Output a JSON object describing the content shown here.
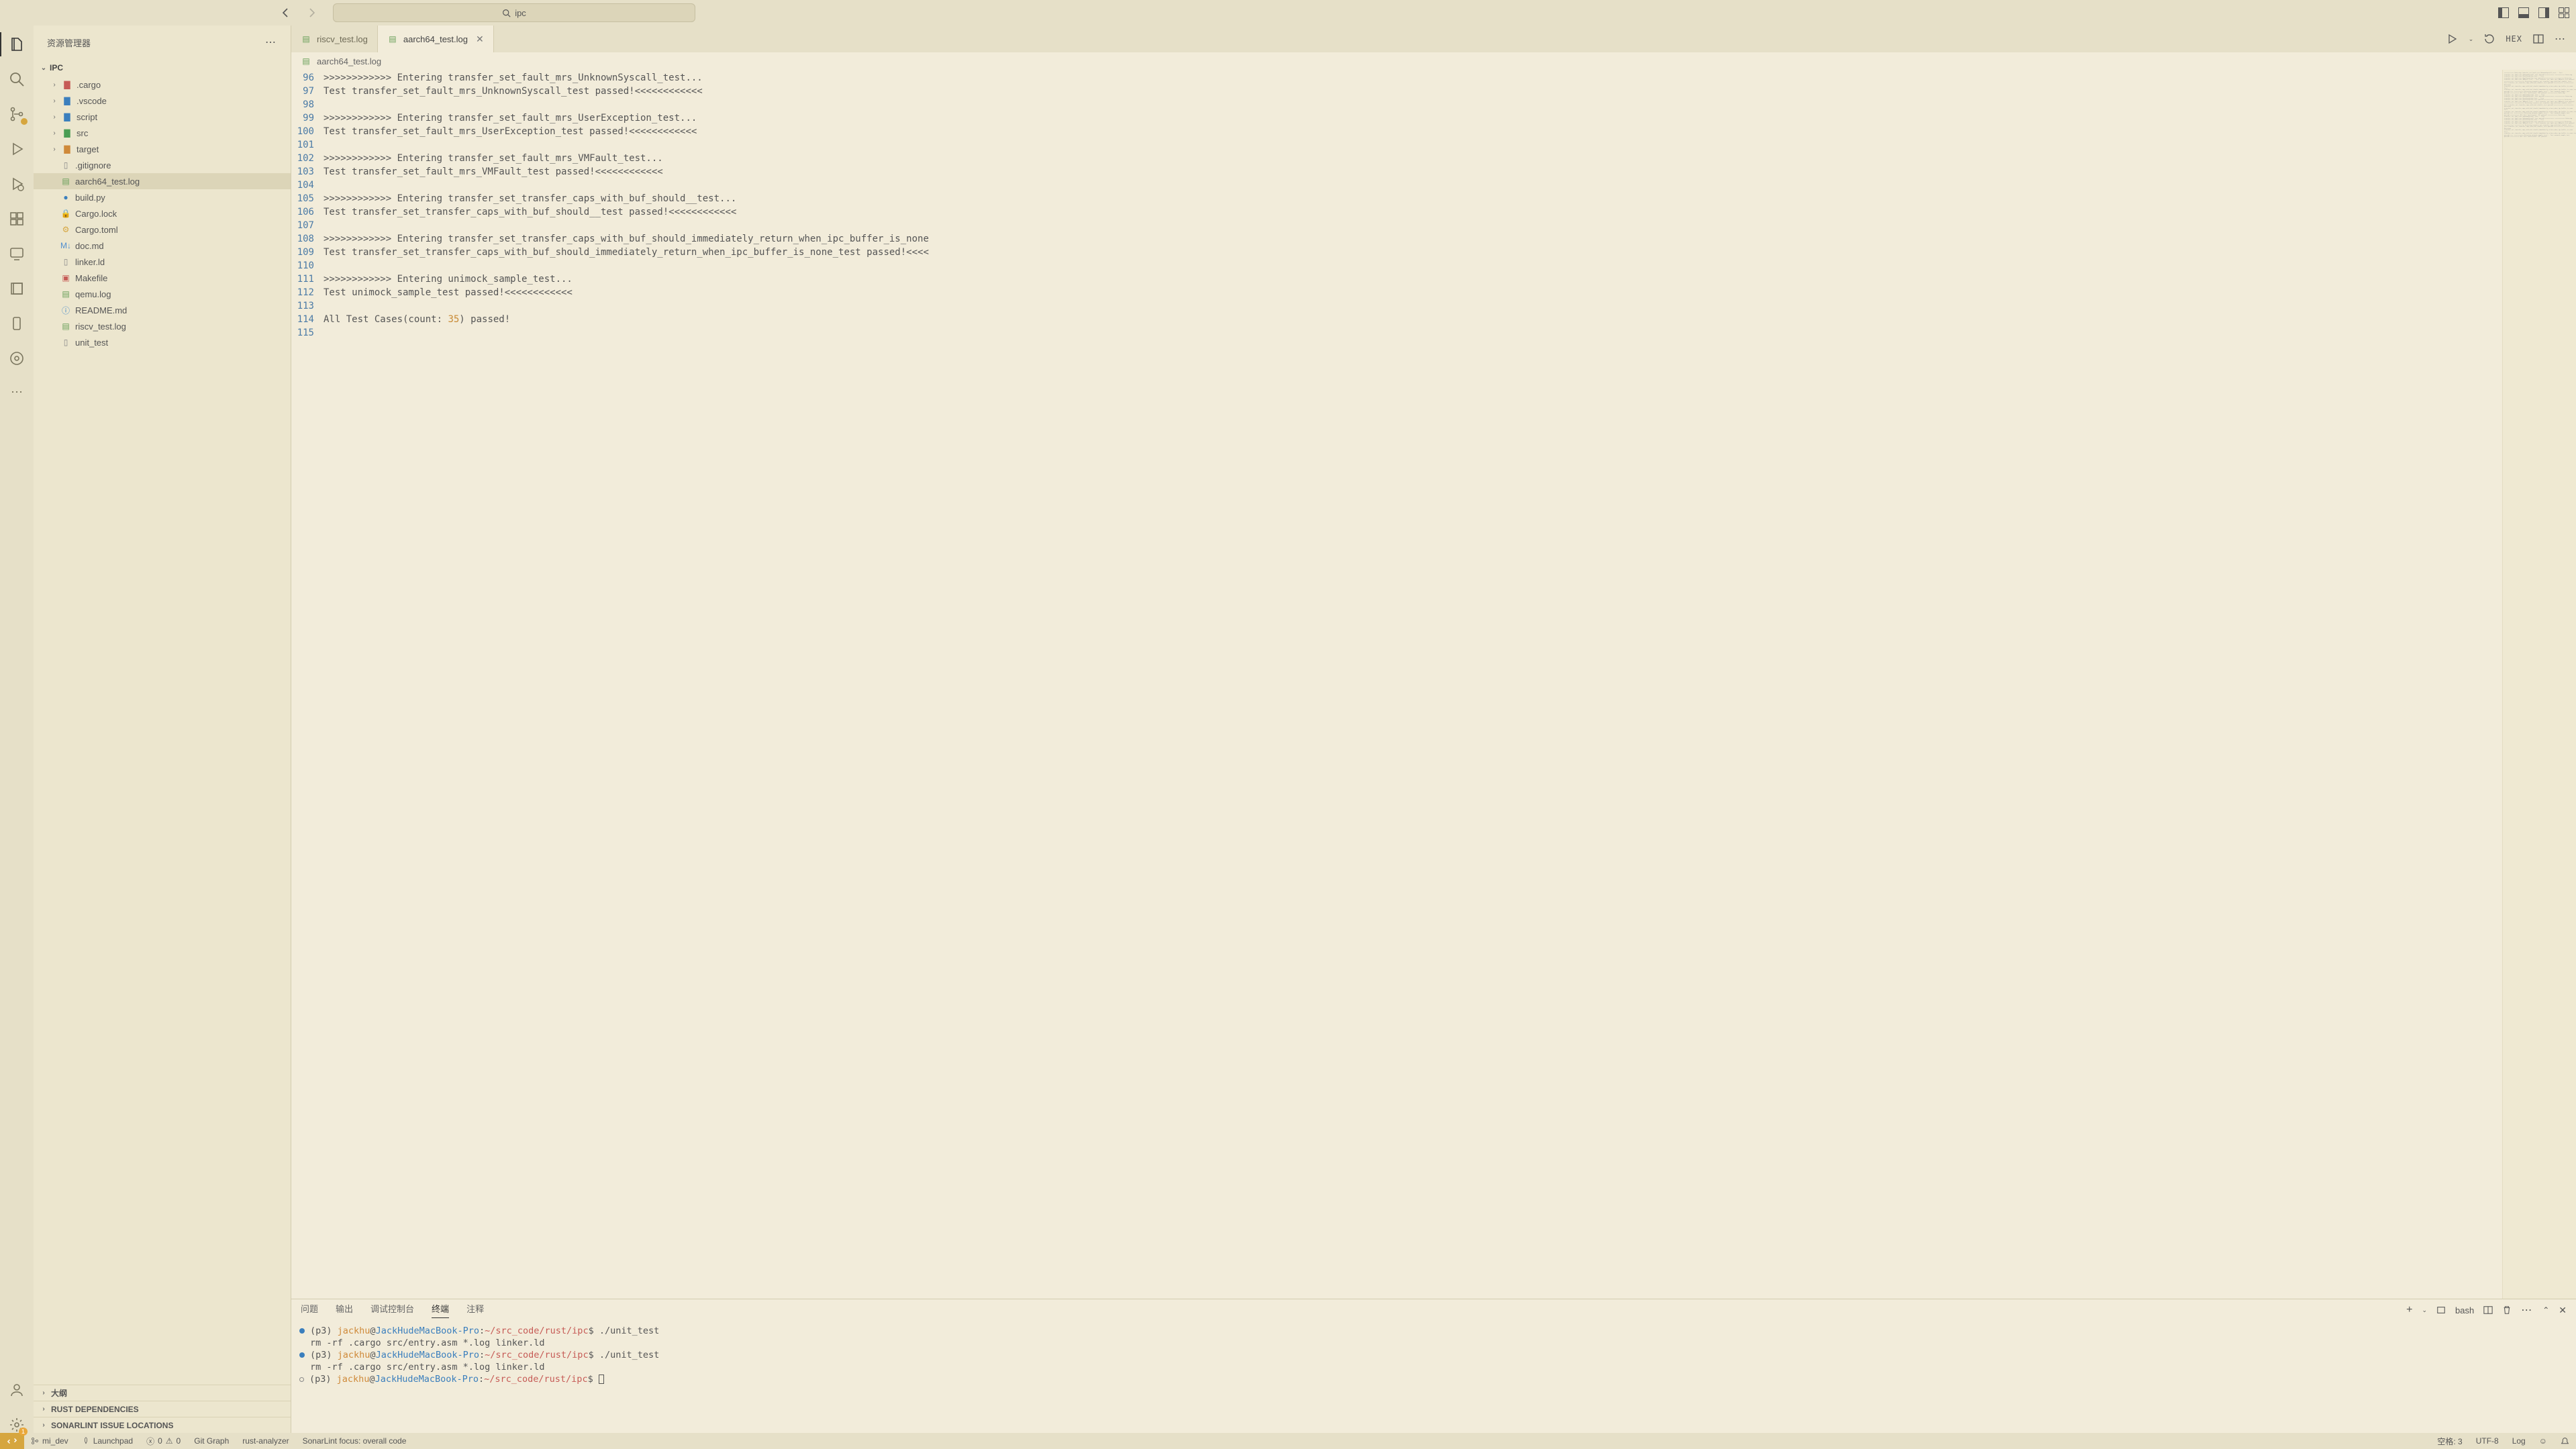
{
  "title": {
    "search_text": "ipc"
  },
  "sidebar": {
    "title": "资源管理器",
    "root": "IPC",
    "folders": [
      {
        "name": ".cargo",
        "iconClass": "folder-red"
      },
      {
        "name": ".vscode",
        "iconClass": "folder-blue"
      },
      {
        "name": "script",
        "iconClass": "folder-blue"
      },
      {
        "name": "src",
        "iconClass": "folder-green"
      },
      {
        "name": "target",
        "iconClass": "folder-orange"
      }
    ],
    "files": [
      {
        "name": ".gitignore",
        "iconClass": "file"
      },
      {
        "name": "aarch64_test.log",
        "iconClass": "log",
        "selected": true
      },
      {
        "name": "build.py",
        "iconClass": "py"
      },
      {
        "name": "Cargo.lock",
        "iconClass": "lock"
      },
      {
        "name": "Cargo.toml",
        "iconClass": "rust"
      },
      {
        "name": "doc.md",
        "iconClass": "md"
      },
      {
        "name": "linker.ld",
        "iconClass": "file"
      },
      {
        "name": "Makefile",
        "iconClass": "mk"
      },
      {
        "name": "qemu.log",
        "iconClass": "log"
      },
      {
        "name": "README.md",
        "iconClass": "readme"
      },
      {
        "name": "riscv_test.log",
        "iconClass": "log"
      },
      {
        "name": "unit_test",
        "iconClass": "file"
      }
    ],
    "sections": [
      {
        "label": "大纲"
      },
      {
        "label": "RUST DEPENDENCIES"
      },
      {
        "label": "SONARLINT ISSUE LOCATIONS"
      }
    ]
  },
  "tabs": [
    {
      "label": "riscv_test.log",
      "active": false
    },
    {
      "label": "aarch64_test.log",
      "active": true
    }
  ],
  "tab_actions": {
    "hex": "HEX"
  },
  "breadcrumb": {
    "file": "aarch64_test.log"
  },
  "editor": {
    "first_line_no": 96,
    "lines": [
      ">>>>>>>>>>>> Entering transfer_set_fault_mrs_UnknownSyscall_test...",
      "Test transfer_set_fault_mrs_UnknownSyscall_test passed!<<<<<<<<<<<<",
      "",
      ">>>>>>>>>>>> Entering transfer_set_fault_mrs_UserException_test...",
      "Test transfer_set_fault_mrs_UserException_test passed!<<<<<<<<<<<<",
      "",
      ">>>>>>>>>>>> Entering transfer_set_fault_mrs_VMFault_test...",
      "Test transfer_set_fault_mrs_VMFault_test passed!<<<<<<<<<<<<",
      "",
      ">>>>>>>>>>>> Entering transfer_set_transfer_caps_with_buf_should__test...",
      "Test transfer_set_transfer_caps_with_buf_should__test passed!<<<<<<<<<<<<",
      "",
      ">>>>>>>>>>>> Entering transfer_set_transfer_caps_with_buf_should_immediately_return_when_ipc_buffer_is_none",
      "Test transfer_set_transfer_caps_with_buf_should_immediately_return_when_ipc_buffer_is_none_test passed!<<<<",
      "",
      ">>>>>>>>>>>> Entering unimock_sample_test...",
      "Test unimock_sample_test passed!<<<<<<<<<<<<",
      "",
      "All Test Cases(count: 35) passed!",
      ""
    ],
    "highlight_number_line_index": 18,
    "highlight_number_text": "35"
  },
  "panel": {
    "tabs": [
      "问题",
      "输出",
      "调试控制台",
      "终端",
      "注释"
    ],
    "active_tab": 3,
    "shell_label": "bash",
    "terminal": {
      "env": "(p3) ",
      "user": "jackhu",
      "host": "JackHudeMacBook-Pro",
      "path": "~/src_code/rust/ipc",
      "cmd": "./unit_test",
      "out": "rm -rf .cargo src/entry.asm *.log linker.ld"
    }
  },
  "status": {
    "branch": "mi_dev",
    "launchpad": "Launchpad",
    "err": "0",
    "warn": "0",
    "gitgraph": "Git Graph",
    "rust": "rust-analyzer",
    "sonar": "SonarLint focus: overall code",
    "spaces": "空格: 3",
    "encoding": "UTF-8",
    "lang": "Log"
  }
}
